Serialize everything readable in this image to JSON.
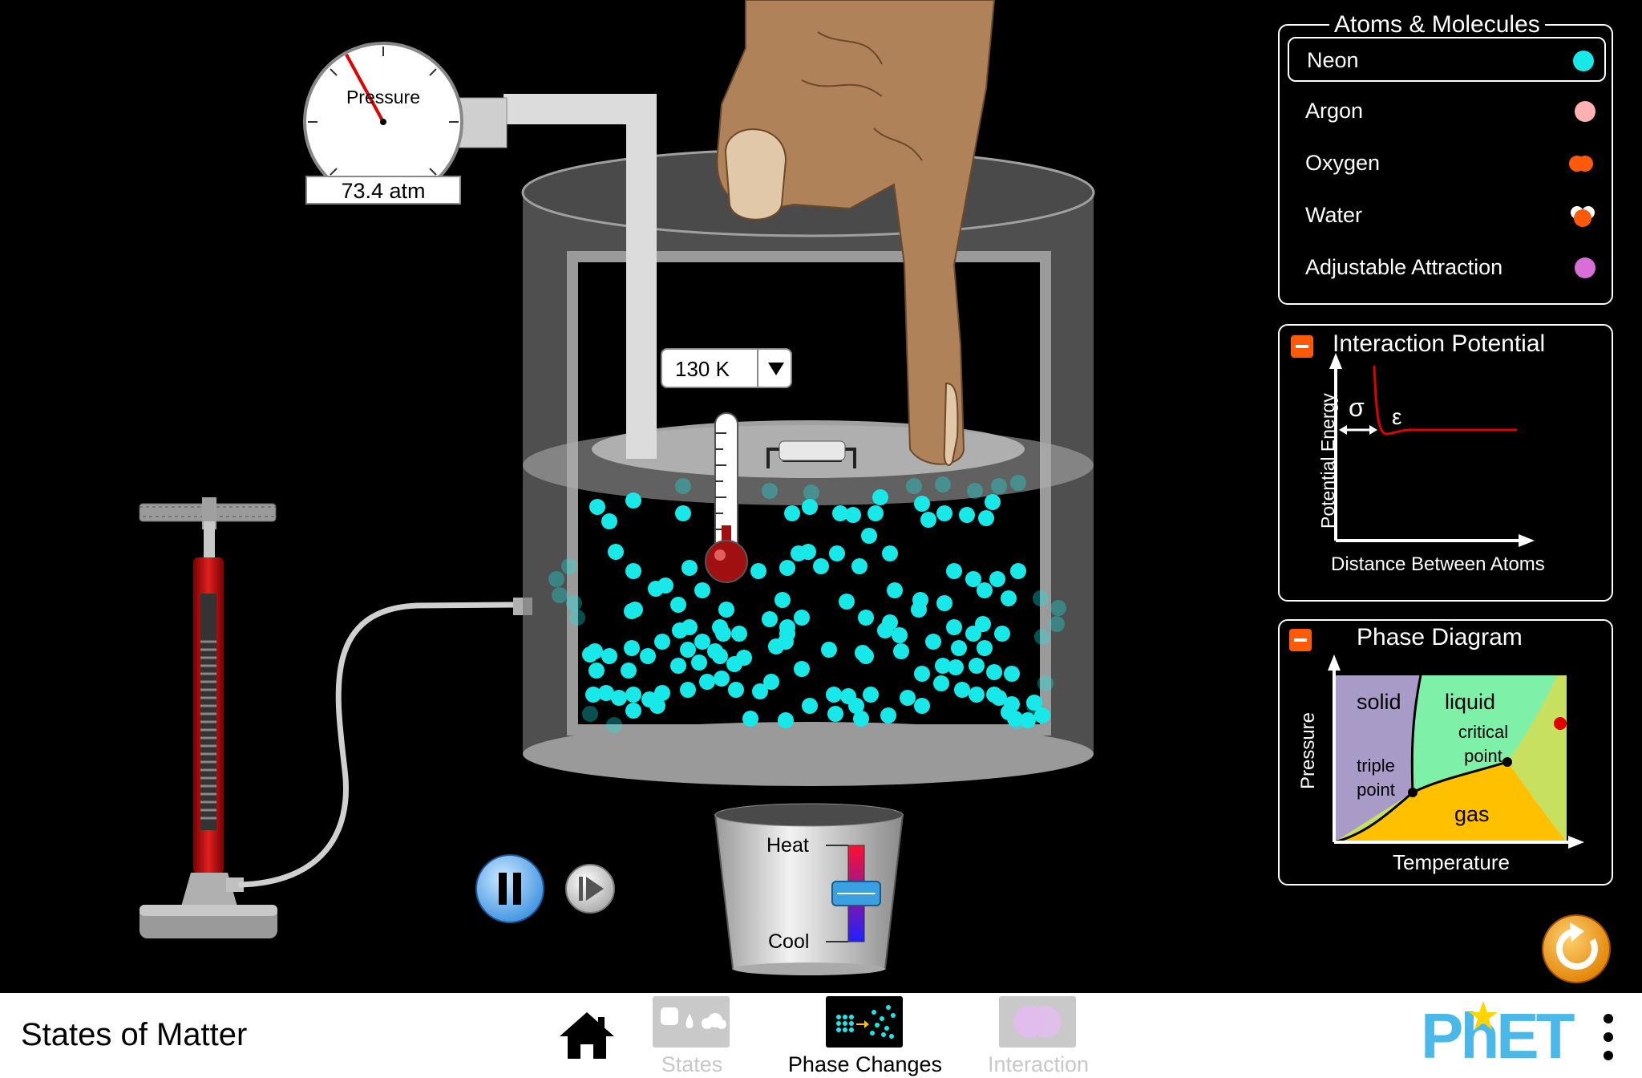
{
  "app": {
    "title": "States of Matter"
  },
  "pressure_gauge": {
    "label": "Pressure",
    "readout": "73.4 atm"
  },
  "thermometer": {
    "readout": "130 K",
    "dropdown_icon": "triangle-down-icon"
  },
  "heater": {
    "heat_label": "Heat",
    "cool_label": "Cool"
  },
  "atoms_panel": {
    "title": "Atoms & Molecules",
    "items": [
      {
        "label": "Neon",
        "color": "#19e8e8",
        "selected": true
      },
      {
        "label": "Argon",
        "color": "#ffb0b0",
        "selected": false
      },
      {
        "label": "Oxygen",
        "color": "#ff5a0a",
        "selected": false
      },
      {
        "label": "Water",
        "color": "#ff5a0a",
        "selected": false
      },
      {
        "label": "Adjustable Attraction",
        "color": "#d86ed8",
        "selected": false
      }
    ]
  },
  "interaction_panel": {
    "title": "Interaction Potential",
    "y_label": "Potential Energy",
    "x_label": "Distance Between Atoms",
    "sigma": "σ",
    "epsilon": "ε"
  },
  "phase_panel": {
    "title": "Phase Diagram",
    "y_label": "Pressure",
    "x_label": "Temperature",
    "regions": {
      "solid": "solid",
      "liquid": "liquid",
      "gas": "gas"
    },
    "points": {
      "critical_1": "critical",
      "critical_2": "point",
      "triple_1": "triple",
      "triple_2": "point"
    },
    "colors": {
      "solid": "#a99bc8",
      "liquid": "#7ff0a8",
      "gas": "#ffc000",
      "supercritical": "#c8e060",
      "marker": "#e00000"
    }
  },
  "nav": {
    "tabs": [
      {
        "label": "States",
        "active": false
      },
      {
        "label": "Phase Changes",
        "active": true
      },
      {
        "label": "Interaction",
        "active": false
      }
    ],
    "brand": "PhET"
  },
  "colors": {
    "particle": "#19e8e8",
    "accent": "#ff5a0a",
    "reset": "#f0940a",
    "play": "#5ab4f0"
  }
}
